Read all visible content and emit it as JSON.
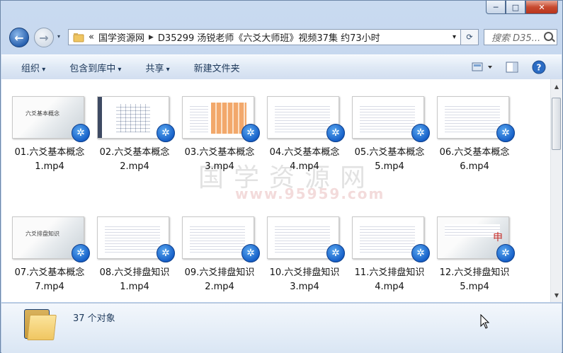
{
  "window": {
    "min_label": "─",
    "max_label": "□",
    "close_label": "✕"
  },
  "nav": {
    "back_glyph": "←",
    "forward_glyph": "→",
    "breadcrumb_overflow": "«",
    "breadcrumb": [
      "国学资源网",
      "D35299 汤锐老师《六爻大师班》视频37集 约73小时"
    ],
    "dropdown_glyph": "▾",
    "refresh_glyph": "⟳",
    "search_placeholder": "搜索 D35..."
  },
  "toolbar": {
    "organize": "组织",
    "include_in_library": "包含到库中",
    "share": "共享",
    "new_folder": "新建文件夹"
  },
  "files": [
    {
      "name": "01.六爻基本概念1.mp4",
      "thumb": "title",
      "thumb_text": "六爻基本概念"
    },
    {
      "name": "02.六爻基本概念2.mp4",
      "thumb": "table"
    },
    {
      "name": "03.六爻基本概念3.mp4",
      "thumb": "grid"
    },
    {
      "name": "04.六爻基本概念4.mp4",
      "thumb": "text"
    },
    {
      "name": "05.六爻基本概念5.mp4",
      "thumb": "text"
    },
    {
      "name": "06.六爻基本概念6.mp4",
      "thumb": "text"
    },
    {
      "name": "07.六爻基本概念7.mp4",
      "thumb": "title",
      "thumb_text": "六爻排盘知识"
    },
    {
      "name": "08.六爻排盘知识1.mp4",
      "thumb": "text"
    },
    {
      "name": "09.六爻排盘知识2.mp4",
      "thumb": "text"
    },
    {
      "name": "10.六爻排盘知识3.mp4",
      "thumb": "text"
    },
    {
      "name": "11.六爻排盘知识4.mp4",
      "thumb": "text"
    },
    {
      "name": "12.六爻排盘知识5.mp4",
      "thumb": "ink",
      "thumb_text": "申"
    }
  ],
  "watermark": {
    "text": "国学资源网",
    "url": "www.95959.com"
  },
  "status": {
    "count": "37 个对象"
  }
}
